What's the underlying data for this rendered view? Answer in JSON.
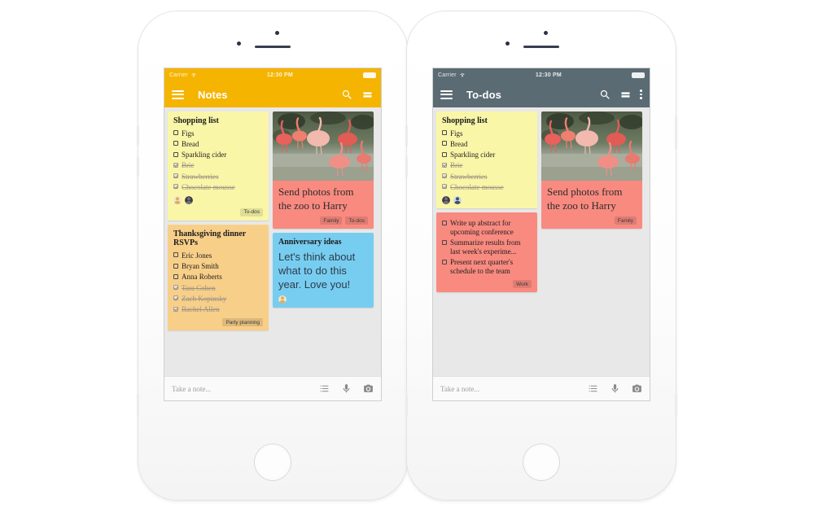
{
  "theme": {
    "notes_accent": "#f5b400",
    "todos_accent": "#5a6b73",
    "board_bg": "#e8e8e8",
    "yellow_note": "#faf6a8",
    "orange_note": "#f8cf89",
    "pink_note": "#f98a80",
    "blue_note": "#77cdf0",
    "chip_bg": "rgba(0,0,0,0.10)"
  },
  "phones": [
    {
      "id": "phone-notes",
      "status_bar": {
        "carrier": "Carrier",
        "time": "12:30 PM",
        "wifi_icon": "wifi-icon",
        "battery_icon": "battery-icon"
      },
      "app_bar": {
        "menu_icon": "hamburger-menu-icon",
        "title": "Notes",
        "search_icon": "search-icon",
        "view_toggle_icon": "list-view-icon",
        "overflow_icon": null
      },
      "columns": [
        {
          "notes": [
            {
              "id": "note-shopping-list",
              "kind": "checklist",
              "color": "#faf6a8",
              "title": "Shopping list",
              "items": [
                {
                  "label": "Figs",
                  "done": false
                },
                {
                  "label": "Bread",
                  "done": false
                },
                {
                  "label": "Sparkling cider",
                  "done": false
                },
                {
                  "label": "Brie",
                  "done": true
                },
                {
                  "label": "Strawberries",
                  "done": true
                },
                {
                  "label": "Chocolate mousse",
                  "done": true
                }
              ],
              "avatars": [
                "collaborator-avatar-1",
                "collaborator-avatar-2"
              ],
              "chips": [
                "To-dos"
              ]
            },
            {
              "id": "note-thanksgiving-rsvp",
              "kind": "checklist",
              "color": "#f8cf89",
              "title": "Thanksgiving dinner RSVPs",
              "items": [
                {
                  "label": "Eric Jones",
                  "done": false
                },
                {
                  "label": "Bryan Smith",
                  "done": false
                },
                {
                  "label": "Anna Roberts",
                  "done": false
                },
                {
                  "label": "Tara Cohen",
                  "done": true
                },
                {
                  "label": "Zach Kopinsky",
                  "done": true
                },
                {
                  "label": "Rachel Allen",
                  "done": true
                }
              ],
              "avatars": [],
              "chips": [
                "Party planning"
              ]
            }
          ]
        },
        {
          "notes": [
            {
              "id": "note-zoo-photos",
              "kind": "photo",
              "color": "#f98a80",
              "photo_alt": "flamingos-photo",
              "text": "Send photos from the zoo to Harry",
              "chips": [
                "Family",
                "To-dos"
              ]
            },
            {
              "id": "note-anniversary-ideas",
              "kind": "text",
              "color": "#77cdf0",
              "title": "Anniversary ideas",
              "text": "Let's think about what to do this year. Love you!",
              "avatars": [
                "collaborator-avatar-3"
              ],
              "chips": []
            }
          ]
        }
      ],
      "composer": {
        "placeholder": "Take a note...",
        "list_icon": "new-list-icon",
        "mic_icon": "microphone-icon",
        "camera_icon": "camera-icon"
      }
    },
    {
      "id": "phone-todos",
      "status_bar": {
        "carrier": "Carrier",
        "time": "12:30 PM",
        "wifi_icon": "wifi-icon",
        "battery_icon": "battery-icon"
      },
      "app_bar": {
        "menu_icon": "hamburger-menu-icon",
        "title": "To-dos",
        "search_icon": "search-icon",
        "view_toggle_icon": "list-view-icon",
        "overflow_icon": "overflow-menu-icon"
      },
      "columns": [
        {
          "notes": [
            {
              "id": "note-shopping-list-2",
              "kind": "checklist",
              "color": "#faf6a8",
              "title": "Shopping list",
              "items": [
                {
                  "label": "Figs",
                  "done": false
                },
                {
                  "label": "Bread",
                  "done": false
                },
                {
                  "label": "Sparkling cider",
                  "done": false
                },
                {
                  "label": "Brie",
                  "done": true
                },
                {
                  "label": "Strawberries",
                  "done": true
                },
                {
                  "label": "Chocolate mousse",
                  "done": true
                }
              ],
              "avatars": [
                "collaborator-avatar-1",
                "collaborator-avatar-2"
              ],
              "chips": []
            },
            {
              "id": "note-work-tasks",
              "kind": "checklist",
              "color": "#f98a80",
              "title": "",
              "items": [
                {
                  "label": "Write up abstract for upcoming conference",
                  "done": false
                },
                {
                  "label": "Summarize results from last week's experime...",
                  "done": false
                },
                {
                  "label": "Present next quarter's schedule to the team",
                  "done": false
                }
              ],
              "avatars": [],
              "chips": [
                "Work"
              ]
            }
          ]
        },
        {
          "notes": [
            {
              "id": "note-zoo-photos-2",
              "kind": "photo",
              "color": "#f98a80",
              "photo_alt": "flamingos-photo",
              "text": "Send photos from the zoo to Harry",
              "chips": [
                "Family"
              ]
            }
          ]
        }
      ],
      "composer": {
        "placeholder": "Take a note...",
        "list_icon": "new-list-icon",
        "mic_icon": "microphone-icon",
        "camera_icon": "camera-icon"
      }
    }
  ]
}
